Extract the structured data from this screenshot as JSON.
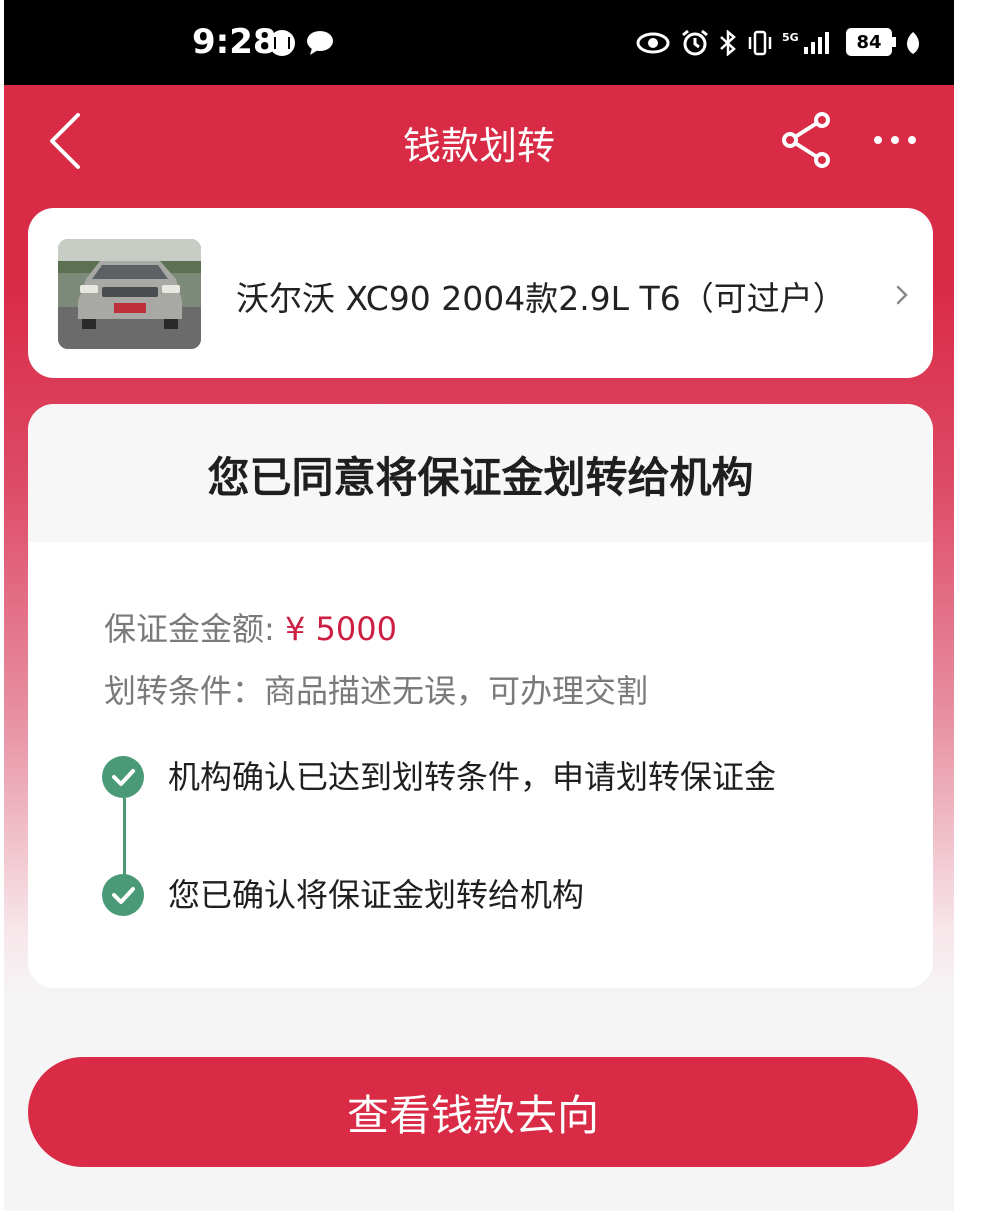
{
  "status_bar": {
    "time": "9:28",
    "battery": "84",
    "icons": [
      "audio-notification-icon",
      "chat-bubble-icon",
      "eye-icon",
      "alarm-icon",
      "bluetooth-icon",
      "vibrate-icon",
      "signal-5g-icon",
      "battery-icon",
      "leaf-icon"
    ]
  },
  "nav": {
    "title": "钱款划转",
    "back_icon": "back-arrow-icon",
    "share_icon": "share-icon",
    "more_icon": "more-icon"
  },
  "car": {
    "title": "沃尔沃 XC90 2004款2.9L T6（可过户）",
    "thumbnail": "car-photo",
    "chevron_icon": "chevron-right-icon"
  },
  "info": {
    "title": "您已同意将保证金划转给机构",
    "amount_label": "保证金金额: ",
    "amount_value": "¥ 5000",
    "condition_label": "划转条件：",
    "condition_value": "商品描述无误，可办理交割",
    "steps": [
      {
        "text": "机构确认已达到划转条件，申请划转保证金",
        "status": "done"
      },
      {
        "text": "您已确认将保证金划转给机构",
        "status": "done"
      }
    ]
  },
  "cta": {
    "label": "查看钱款去向"
  },
  "colors": {
    "brand_red": "#d92a46",
    "amount_red": "#cc1f43",
    "check_green": "#4a9a78"
  }
}
